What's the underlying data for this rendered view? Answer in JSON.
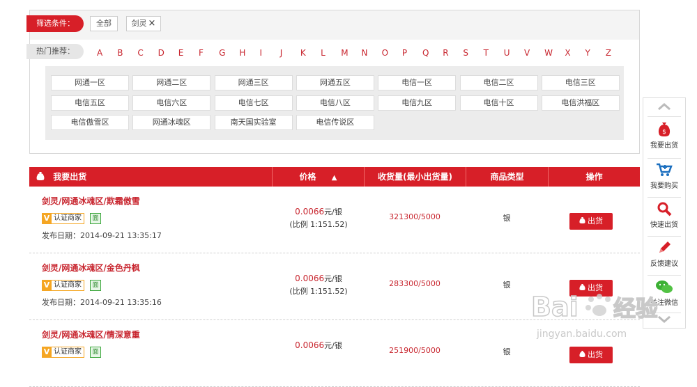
{
  "filter": {
    "label": "筛选条件：",
    "chips": [
      {
        "label": "全部"
      },
      {
        "label": "剑灵",
        "close": "×"
      }
    ]
  },
  "hot": {
    "label": "热门推荐：",
    "letters": [
      "A",
      "B",
      "C",
      "D",
      "E",
      "F",
      "G",
      "H",
      "I",
      "J",
      "K",
      "L",
      "M",
      "N",
      "O",
      "P",
      "Q",
      "R",
      "S",
      "T",
      "U",
      "V",
      "W",
      "X",
      "Y",
      "Z"
    ]
  },
  "servers": [
    "网通一区",
    "网通二区",
    "网通三区",
    "网通五区",
    "电信一区",
    "电信二区",
    "电信三区",
    "电信五区",
    "电信六区",
    "电信七区",
    "电信八区",
    "电信九区",
    "电信十区",
    "电信洪福区",
    "电信傲雪区",
    "网通冰魂区",
    "南天国实验室",
    "电信传说区"
  ],
  "table": {
    "headers": {
      "sell": "我要出货",
      "price": "价格",
      "sort": "▲",
      "qty": "收货量(最小出货量)",
      "type": "商品类型",
      "op": "操作"
    },
    "rows": [
      {
        "title": "剑灵/网通冰魂区/欺霜傲雪",
        "v": "V",
        "cert": "认证商家",
        "mian": "面",
        "date": "发布日期：2014-09-21 13:35:17",
        "price": "0.0066",
        "unit": "元/银",
        "ratio": "(比例 1:151.52)",
        "qty": "321300/5000",
        "type": "银",
        "btn": "出货"
      },
      {
        "title": "剑灵/网通冰魂区/金色丹枫",
        "v": "V",
        "cert": "认证商家",
        "mian": "面",
        "date": "发布日期：2014-09-21 13:35:16",
        "price": "0.0066",
        "unit": "元/银",
        "ratio": "(比例 1:151.52)",
        "qty": "283300/5000",
        "type": "银",
        "btn": "出货"
      },
      {
        "title": "剑灵/网通冰魂区/情深意重",
        "v": "V",
        "cert": "认证商家",
        "mian": "面",
        "date": "",
        "price": "0.0066",
        "unit": "元/银",
        "ratio": "",
        "qty": "251900/5000",
        "type": "银",
        "btn": "出货"
      }
    ]
  },
  "sidebar": {
    "items": [
      {
        "label": "我要出货",
        "icon": "money-bag-icon"
      },
      {
        "label": "我要购买",
        "icon": "cart-icon"
      },
      {
        "label": "快速出货",
        "icon": "search-icon"
      },
      {
        "label": "反馈建议",
        "icon": "pencil-icon"
      },
      {
        "label": "关注微信",
        "icon": "wechat-icon"
      }
    ]
  },
  "watermark": {
    "brand": "Bai",
    "brand2": "经验",
    "url": "jingyan.baidu.com"
  },
  "colors": {
    "accent": "#d71f28",
    "link": "#c8262f",
    "badge": "#f5a623"
  }
}
